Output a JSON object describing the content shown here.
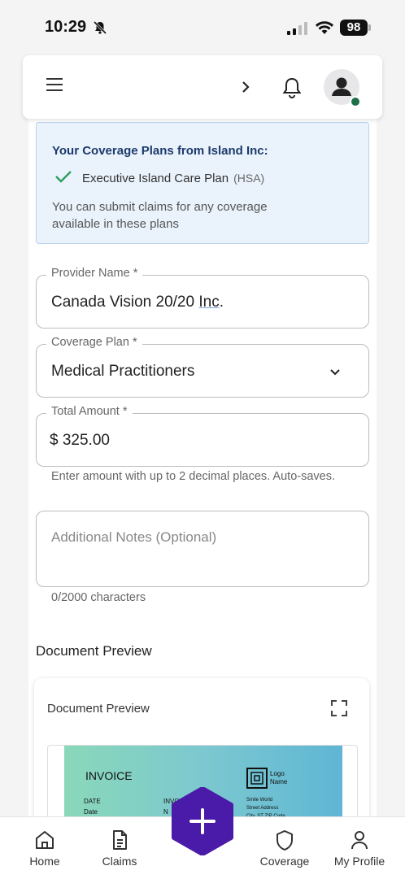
{
  "status_bar": {
    "time": "10:29",
    "battery": "98"
  },
  "header": {},
  "coverage": {
    "title": "Your Coverage Plans from Island Inc:",
    "plan_name": "Executive Island Care Plan",
    "plan_tag": "(HSA)",
    "description": "You can submit claims for any coverage available in these plans"
  },
  "form": {
    "provider": {
      "label": "Provider Name *",
      "value_main": "Canada Vision 20/20 ",
      "value_underlined": "Inc",
      "value_end": "."
    },
    "coverage_plan": {
      "label": "Coverage Plan *",
      "value": "Medical Practitioners"
    },
    "total_amount": {
      "label": "Total Amount *",
      "currency": "$",
      "value": "325.00",
      "helper": "Enter amount with up to 2 decimal places. Auto-saves."
    },
    "notes": {
      "placeholder": "Additional Notes (Optional)",
      "counter": "0/2000 characters"
    }
  },
  "document_preview": {
    "section_title": "Document Preview",
    "card_title": "Document Preview",
    "invoice": {
      "title": "INVOICE",
      "date_label": "DATE",
      "date_value": "Date",
      "col_label": "INVO",
      "col_value": "N",
      "logo_line1": "Logo",
      "logo_line2": "Name",
      "addr_line1": "Smile World",
      "addr_line2": "Street Address",
      "addr_line3": "City, ST ZIP Code"
    }
  },
  "nav": {
    "home": "Home",
    "claims": "Claims",
    "coverage": "Coverage",
    "profile": "My Profile"
  },
  "colors": {
    "accent": "#4a1aa8",
    "check": "#2e9e5b",
    "info_bg": "#eaf3fc"
  }
}
